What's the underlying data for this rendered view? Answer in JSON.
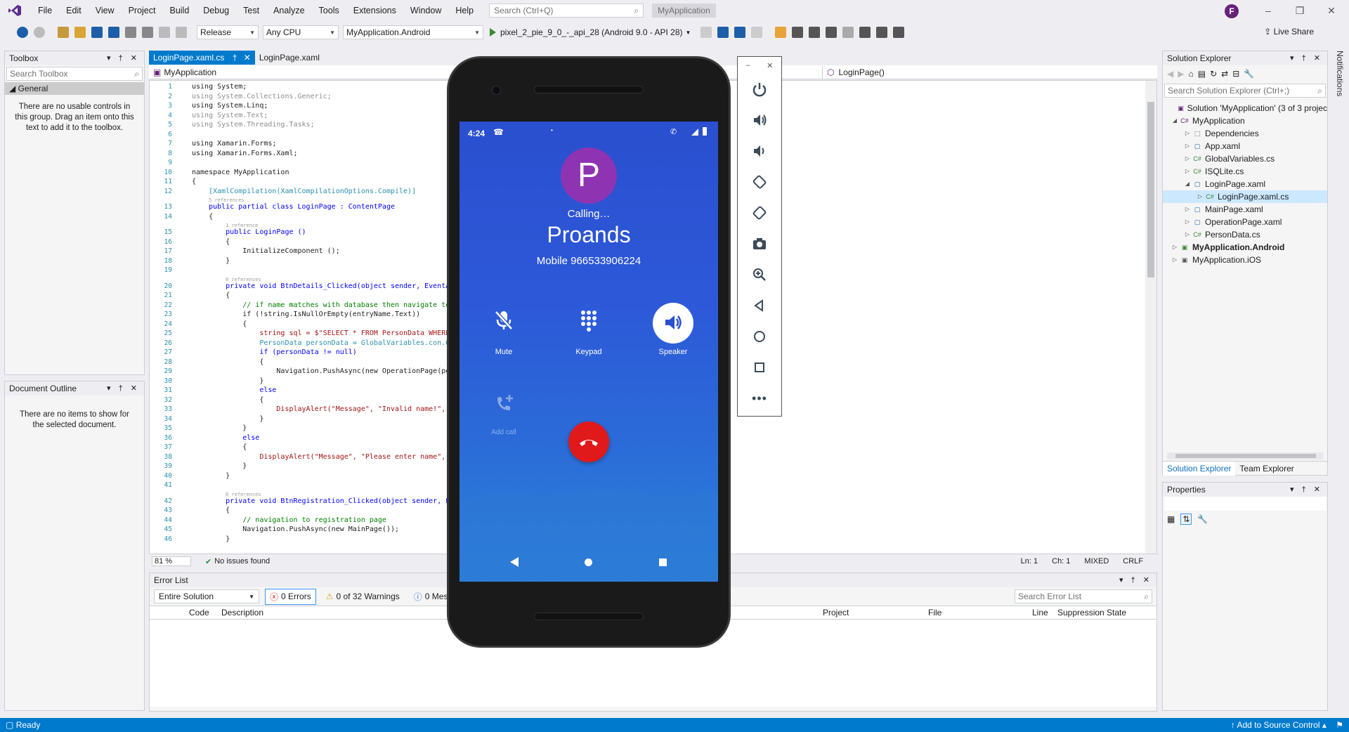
{
  "menu": {
    "items": [
      "File",
      "Edit",
      "View",
      "Project",
      "Build",
      "Debug",
      "Test",
      "Analyze",
      "Tools",
      "Extensions",
      "Window",
      "Help"
    ],
    "search_placeholder": "Search (Ctrl+Q)",
    "app_name": "MyApplication",
    "avatar_letter": "F"
  },
  "toolbar": {
    "config": "Release",
    "platform": "Any CPU",
    "project": "MyApplication.Android",
    "device": "pixel_2_pie_9_0_-_api_28 (Android 9.0 - API 28)",
    "live_share": "Live Share"
  },
  "toolbox": {
    "title": "Toolbox",
    "search_placeholder": "Search Toolbox",
    "group": "General",
    "message": "There are no usable controls in this group. Drag an item onto this text to add it to the toolbox."
  },
  "outline": {
    "title": "Document Outline",
    "message": "There are no items to show for the selected document."
  },
  "editor": {
    "tabs": [
      "LoginPage.xaml.cs",
      "LoginPage.xaml"
    ],
    "nav_left": "MyApplication",
    "nav_right": "LoginPage()",
    "zoom": "81 %",
    "issues": "No issues found",
    "ln": "Ln: 1",
    "ch": "Ch: 1",
    "mode": "MIXED",
    "eol": "CRLF"
  },
  "code_lines": [
    {
      "n": "1",
      "t": "using System;"
    },
    {
      "n": "2",
      "t": "using System.Collections.Generic;"
    },
    {
      "n": "3",
      "t": "using System.Linq;"
    },
    {
      "n": "4",
      "t": "using System.Text;"
    },
    {
      "n": "5",
      "t": "using System.Threading.Tasks;"
    },
    {
      "n": "6",
      "t": ""
    },
    {
      "n": "7",
      "t": "using Xamarin.Forms;"
    },
    {
      "n": "8",
      "t": "using Xamarin.Forms.Xaml;"
    },
    {
      "n": "9",
      "t": ""
    },
    {
      "n": "10",
      "t": "namespace MyApplication"
    },
    {
      "n": "11",
      "t": "{"
    },
    {
      "n": "12",
      "t": "    [XamlCompilation(XamlCompilationOptions.Compile)]"
    },
    {
      "n": "13",
      "t": "    public partial class LoginPage : ContentPage"
    },
    {
      "n": "14",
      "t": "    {"
    },
    {
      "n": "15",
      "t": "        public LoginPage ()"
    },
    {
      "n": "16",
      "t": "        {"
    },
    {
      "n": "17",
      "t": "            InitializeComponent ();"
    },
    {
      "n": "18",
      "t": "        }"
    },
    {
      "n": "19",
      "t": ""
    },
    {
      "n": "20",
      "t": "        private void BtnDetails_Clicked(object sender, EventA"
    },
    {
      "n": "21",
      "t": "        {"
    },
    {
      "n": "22",
      "t": "            // if name matches with database then navigate to"
    },
    {
      "n": "23",
      "t": "            if (!string.IsNullOrEmpty(entryName.Text))"
    },
    {
      "n": "24",
      "t": "            {"
    },
    {
      "n": "25",
      "t": "                string sql = $\"SELECT * FROM PersonData WHERE"
    },
    {
      "n": "26",
      "t": "                PersonData personData = GlobalVariables.con.Q"
    },
    {
      "n": "27",
      "t": "                if (personData != null)"
    },
    {
      "n": "28",
      "t": "                {"
    },
    {
      "n": "29",
      "t": "                    Navigation.PushAsync(new OperationPage(pe"
    },
    {
      "n": "30",
      "t": "                }"
    },
    {
      "n": "31",
      "t": "                else"
    },
    {
      "n": "32",
      "t": "                {"
    },
    {
      "n": "33",
      "t": "                    DisplayAlert(\"Message\", \"Invalid name!\","
    },
    {
      "n": "34",
      "t": "                }"
    },
    {
      "n": "35",
      "t": "            }"
    },
    {
      "n": "36",
      "t": "            else"
    },
    {
      "n": "37",
      "t": "            {"
    },
    {
      "n": "38",
      "t": "                DisplayAlert(\"Message\", \"Please enter name\","
    },
    {
      "n": "39",
      "t": "            }"
    },
    {
      "n": "40",
      "t": "        }"
    },
    {
      "n": "41",
      "t": ""
    },
    {
      "n": "42",
      "t": "        private void BtnRegistration_Clicked(object sender, E"
    },
    {
      "n": "43",
      "t": "        {"
    },
    {
      "n": "44",
      "t": "            // navigation to registration page"
    },
    {
      "n": "45",
      "t": "            Navigation.PushAsync(new MainPage());"
    },
    {
      "n": "46",
      "t": "        }"
    }
  ],
  "code_refs": {
    "r12": "5 references",
    "r15": "1 reference",
    "r20": "0 references",
    "r42": "0 references"
  },
  "error_list": {
    "title": "Error List",
    "scope": "Entire Solution",
    "errors": "0 Errors",
    "warnings": "0 of 32 Warnings",
    "messages": "0 Mes",
    "search_placeholder": "Search Error List",
    "columns": [
      "Code",
      "Description",
      "Project",
      "File",
      "Line",
      "Suppression State"
    ]
  },
  "solution_explorer": {
    "title": "Solution Explorer",
    "search_placeholder": "Search Solution Explorer (Ctrl+;)",
    "items": [
      {
        "label": "Solution 'MyApplication' (3 of 3 projec",
        "bold": false
      },
      {
        "label": "MyApplication",
        "bold": false
      },
      {
        "label": "Dependencies",
        "bold": false
      },
      {
        "label": "App.xaml",
        "bold": false
      },
      {
        "label": "GlobalVariables.cs",
        "bold": false
      },
      {
        "label": "ISQLite.cs",
        "bold": false
      },
      {
        "label": "LoginPage.xaml",
        "bold": false
      },
      {
        "label": "LoginPage.xaml.cs",
        "bold": false
      },
      {
        "label": "MainPage.xaml",
        "bold": false
      },
      {
        "label": "OperationPage.xaml",
        "bold": false
      },
      {
        "label": "PersonData.cs",
        "bold": false
      },
      {
        "label": "MyApplication.Android",
        "bold": true
      },
      {
        "label": "MyApplication.iOS",
        "bold": false
      }
    ],
    "tab_solution": "Solution Explorer",
    "tab_team": "Team Explorer"
  },
  "properties": {
    "title": "Properties"
  },
  "notifications_label": "Notifications",
  "status": {
    "ready": "Ready",
    "source_control": "Add to Source Control"
  },
  "phone": {
    "time": "4:24",
    "avatar_letter": "P",
    "avatar_color": "#8e34b3",
    "calling": "Calling…",
    "contact": "Proands",
    "number": "Mobile 966533906224",
    "mute": "Mute",
    "keypad": "Keypad",
    "speaker": "Speaker",
    "add_call": "Add call",
    "end_color": "#e01a1a"
  }
}
